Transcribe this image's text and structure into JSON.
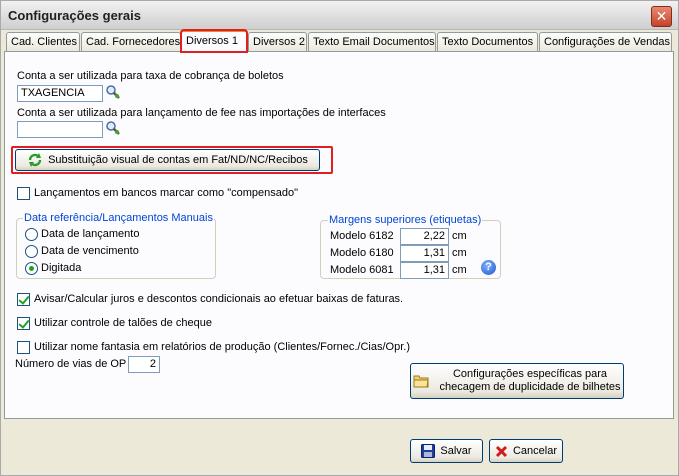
{
  "window": {
    "title": "Configurações gerais"
  },
  "tabs": [
    {
      "label": "Cad. Clientes"
    },
    {
      "label": "Cad. Fornecedores"
    },
    {
      "label": "Diversos 1"
    },
    {
      "label": "Diversos 2"
    },
    {
      "label": "Texto Email Documentos"
    },
    {
      "label": "Texto Documentos"
    },
    {
      "label": "Configurações de Vendas"
    }
  ],
  "fields": {
    "taxa_label": "Conta a ser utilizada para taxa de cobrança de boletos",
    "taxa_value": "TXAGENCIA",
    "fee_label": "Conta a ser utilizada para lançamento de fee nas importações de interfaces",
    "fee_value": ""
  },
  "buttons": {
    "substituicao": "Substituição visual de contas em Fat/ND/NC/Recibos",
    "duplicidade_line1": "Configurações específicas para",
    "duplicidade_line2": "checagem de duplicidade de bilhetes",
    "salvar": "Salvar",
    "cancelar": "Cancelar"
  },
  "checkboxes": {
    "compensado": {
      "label": "Lançamentos em bancos marcar como \"compensado\"",
      "checked": false
    },
    "juros": {
      "label": "Avisar/Calcular juros e descontos condicionais ao efetuar baixas de faturas.",
      "checked": true
    },
    "taloes": {
      "label": "Utilizar controle de talões de cheque",
      "checked": true
    },
    "fantasia": {
      "label": "Utilizar nome fantasia em relatórios de produção (Clientes/Fornec./Cias/Opr.)",
      "checked": false
    }
  },
  "data_referencia": {
    "legend": "Data referência/Lançamentos Manuais",
    "options": [
      "Data de lançamento",
      "Data de vencimento",
      "Digitada"
    ],
    "selected": "Digitada"
  },
  "margens": {
    "legend": "Margens superiores (etiquetas)",
    "rows": [
      {
        "label": "Modelo 6182",
        "value": "2,22",
        "unit": "cm"
      },
      {
        "label": "Modelo 6180",
        "value": "1,31",
        "unit": "cm"
      },
      {
        "label": "Modelo 6081",
        "value": "1,31",
        "unit": "cm"
      }
    ]
  },
  "vias": {
    "label": "Número de vias de OP",
    "value": "2"
  },
  "colors": {
    "accent": "#0046d5",
    "highlight": "#e02020",
    "check": "#21a121"
  }
}
